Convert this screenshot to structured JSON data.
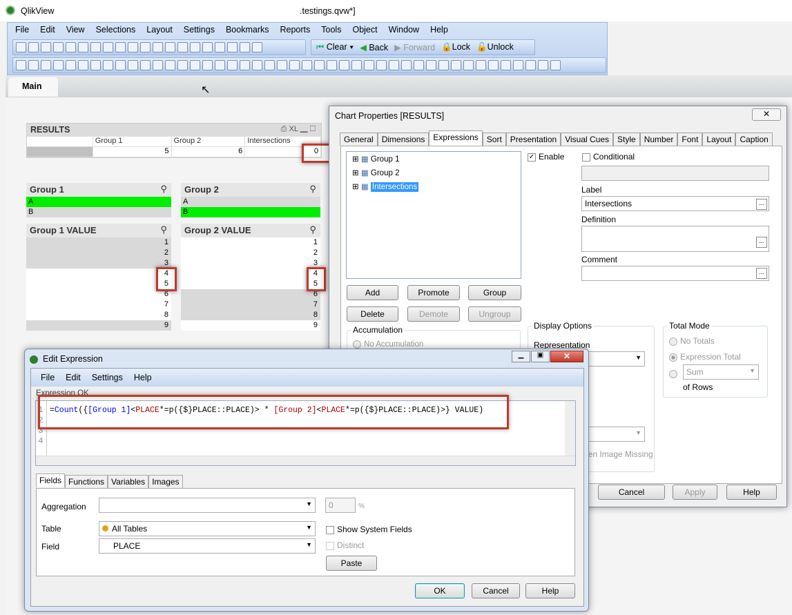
{
  "app": {
    "name": "QlikView",
    "doc_title": ".testings.qvw*]"
  },
  "menu": [
    "File",
    "Edit",
    "View",
    "Selections",
    "Layout",
    "Settings",
    "Bookmarks",
    "Reports",
    "Tools",
    "Object",
    "Window",
    "Help"
  ],
  "toolbar": {
    "clear": "Clear",
    "back": "Back",
    "forward": "Forward",
    "lock": "Lock",
    "unlock": "Unlock"
  },
  "sheet_tab": "Main",
  "results": {
    "title": "RESULTS",
    "xl": "XL",
    "headers": [
      "",
      "Group 1",
      "Group 2",
      "Intersections"
    ],
    "values": [
      "",
      "5",
      "6",
      "0"
    ]
  },
  "listboxes": [
    {
      "title": "Group 1",
      "items": [
        {
          "v": "A",
          "state": "selected"
        },
        {
          "v": "B",
          "state": "excluded"
        }
      ]
    },
    {
      "title": "Group 2",
      "items": [
        {
          "v": "A",
          "state": "excluded"
        },
        {
          "v": "B",
          "state": "selected"
        }
      ]
    },
    {
      "title": "Group 1 VALUE",
      "items": [
        "1",
        "2",
        "3",
        "4",
        "5",
        "6",
        "7",
        "8",
        "9"
      ],
      "states": [
        "excluded",
        "excluded",
        "excluded",
        "possible",
        "possible",
        "possible",
        "possible",
        "possible",
        "excluded"
      ]
    },
    {
      "title": "Group 2 VALUE",
      "items": [
        "1",
        "2",
        "3",
        "4",
        "5",
        "6",
        "7",
        "8",
        "9"
      ],
      "states": [
        "possible",
        "possible",
        "possible",
        "possible",
        "possible",
        "excluded",
        "excluded",
        "excluded",
        "possible"
      ]
    }
  ],
  "chart_props": {
    "title": "Chart Properties [RESULTS]",
    "tabs": [
      "General",
      "Dimensions",
      "Expressions",
      "Sort",
      "Presentation",
      "Visual Cues",
      "Style",
      "Number",
      "Font",
      "Layout",
      "Caption"
    ],
    "active_tab": "Expressions",
    "expressions": [
      "Group 1",
      "Group 2",
      "Intersections"
    ],
    "enable": "Enable",
    "conditional": "Conditional",
    "label_caption": "Label",
    "label_value": "Intersections",
    "definition_caption": "Definition",
    "comment_caption": "Comment",
    "buttons": {
      "add": "Add",
      "promote": "Promote",
      "group": "Group",
      "delete": "Delete",
      "demote": "Demote",
      "ungroup": "Ungroup"
    },
    "accumulation": "Accumulation",
    "no_accumulation": "No Accumulation",
    "display_options": "Display Options",
    "representation": "Representation",
    "image_missing": "hen Image Missing",
    "total_mode": "Total Mode",
    "no_totals": "No Totals",
    "expression_total": "Expression Total",
    "sum": "Sum",
    "of_rows": "of Rows",
    "cancel": "Cancel",
    "apply": "Apply",
    "help": "Help"
  },
  "edit_expr": {
    "title": "Edit Expression",
    "menu": [
      "File",
      "Edit",
      "Settings",
      "Help"
    ],
    "status": "Expression OK",
    "line_numbers": [
      "1",
      "2",
      "3",
      "4"
    ],
    "expression": "=Count({[Group 1]<PLACE*=p({$}PLACE::PLACE)> * [Group 2]<PLACE*=p({$}PLACE::PLACE)>} VALUE)",
    "tabs": [
      "Fields",
      "Functions",
      "Variables",
      "Images"
    ],
    "aggregation": "Aggregation",
    "table": "Table",
    "table_value": "All Tables",
    "field": "Field",
    "field_value": "PLACE",
    "percent_value": "0",
    "percent": "%",
    "show_system": "Show System Fields",
    "distinct": "Distinct",
    "paste": "Paste",
    "ok": "OK",
    "cancel": "Cancel",
    "help": "Help"
  }
}
